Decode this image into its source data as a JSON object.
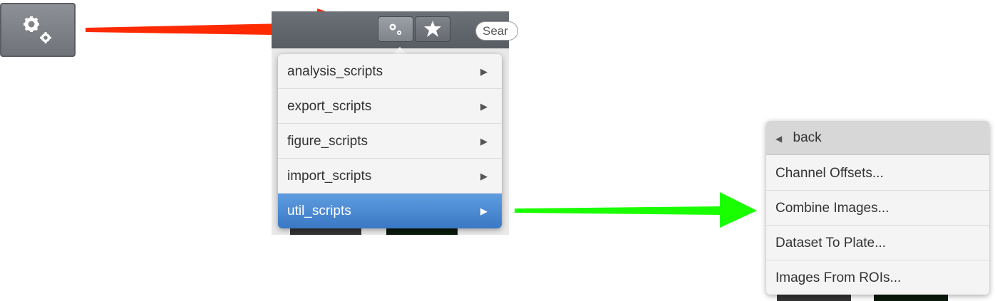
{
  "toolbar": {
    "search_placeholder": "Sear"
  },
  "scripts_menu": {
    "items": [
      {
        "label": "analysis_scripts",
        "arrow": "▶"
      },
      {
        "label": "export_scripts",
        "arrow": "▶"
      },
      {
        "label": "figure_scripts",
        "arrow": "▶"
      },
      {
        "label": "import_scripts",
        "arrow": "▶"
      },
      {
        "label": "util_scripts",
        "arrow": "▶",
        "selected": true
      }
    ]
  },
  "submenu": {
    "back_arrow": "◀",
    "back_label": "back",
    "items": [
      {
        "label": "Channel Offsets..."
      },
      {
        "label": "Combine Images..."
      },
      {
        "label": "Dataset To Plate..."
      },
      {
        "label": "Images From ROIs..."
      }
    ]
  },
  "annotations": {
    "red_arrow_color": "#ff2a00",
    "green_arrow_color": "#1aff00"
  },
  "colors": {
    "selection_blue": "#4a8ad6",
    "toolbar_gray": "#62666d"
  }
}
